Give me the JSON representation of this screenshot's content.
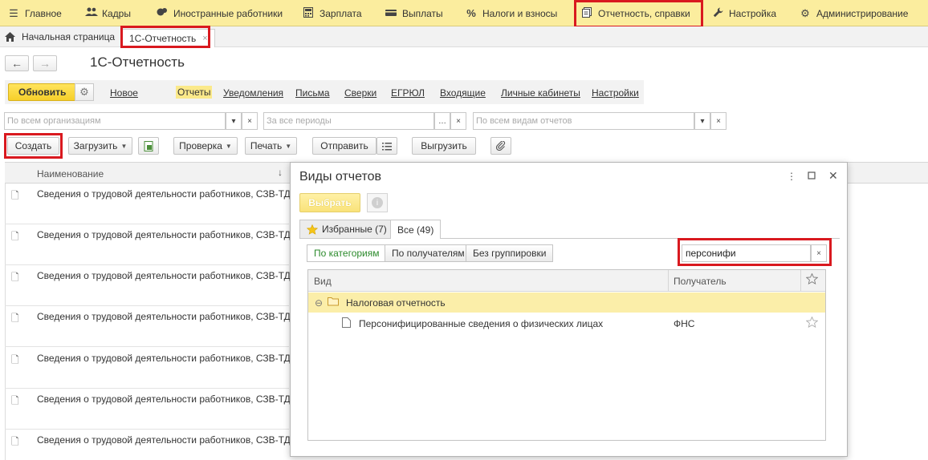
{
  "menu": [
    {
      "label": "Главное",
      "icon": "hamburger-icon",
      "glyph": "☰"
    },
    {
      "label": "Кадры",
      "icon": "people-icon",
      "glyph": "👥"
    },
    {
      "label": "Иностранные работники",
      "icon": "foreign-workers-icon",
      "glyph": "●"
    },
    {
      "label": "Зарплата",
      "icon": "calculator-icon",
      "glyph": "▦"
    },
    {
      "label": "Выплаты",
      "icon": "wallet-icon",
      "glyph": "▬"
    },
    {
      "label": "Налоги и взносы",
      "icon": "percent-icon",
      "glyph": "%"
    },
    {
      "label": "Отчетность, справки",
      "icon": "report-icon",
      "glyph": "▤"
    },
    {
      "label": "Настройка",
      "icon": "wrench-icon",
      "glyph": "🔧"
    },
    {
      "label": "Администрирование",
      "icon": "gear-icon",
      "glyph": "⚙"
    }
  ],
  "tabs": {
    "home_label": "Начальная страница",
    "active_tab": "1С-Отчетность",
    "close_glyph": "×"
  },
  "page": {
    "title": "1С-Отчетность"
  },
  "links": {
    "refresh": "Обновить",
    "items": [
      "Новое",
      "Отчеты",
      "Уведомления",
      "Письма",
      "Сверки",
      "ЕГРЮЛ",
      "Входящие",
      "Личные кабинеты",
      "Настройки"
    ],
    "active": "Отчеты"
  },
  "filters": {
    "organizations_placeholder": "По всем организациям",
    "periods_placeholder": "За все периоды",
    "report_types_placeholder": "По всем видам отчетов"
  },
  "toolbar": {
    "create": "Создать",
    "load": "Загрузить",
    "check": "Проверка",
    "print": "Печать",
    "send": "Отправить",
    "upload": "Выгрузить"
  },
  "list": {
    "column_name": "Наименование",
    "rows": [
      "Сведения о трудовой деятельности работников, СЗВ-ТД",
      "Сведения о трудовой деятельности работников, СЗВ-ТД",
      "Сведения о трудовой деятельности работников, СЗВ-ТД",
      "Сведения о трудовой деятельности работников, СЗВ-ТД",
      "Сведения о трудовой деятельности работников, СЗВ-ТД",
      "Сведения о трудовой деятельности работников, СЗВ-ТД",
      "Сведения о трудовой деятельности работников, СЗВ-ТД"
    ]
  },
  "dialog": {
    "title": "Виды отчетов",
    "select_button": "Выбрать",
    "tab_favorites": "Избранные (7)",
    "tab_all": "Все (49)",
    "grouping": [
      "По категориям",
      "По получателям",
      "Без группировки"
    ],
    "search_value": "персонифи",
    "columns": {
      "kind": "Вид",
      "recipient": "Получатель"
    },
    "group_row": "Налоговая отчетность",
    "item_row": {
      "name": "Персонифицированные сведения о физических лицах",
      "recipient": "ФНС"
    }
  }
}
